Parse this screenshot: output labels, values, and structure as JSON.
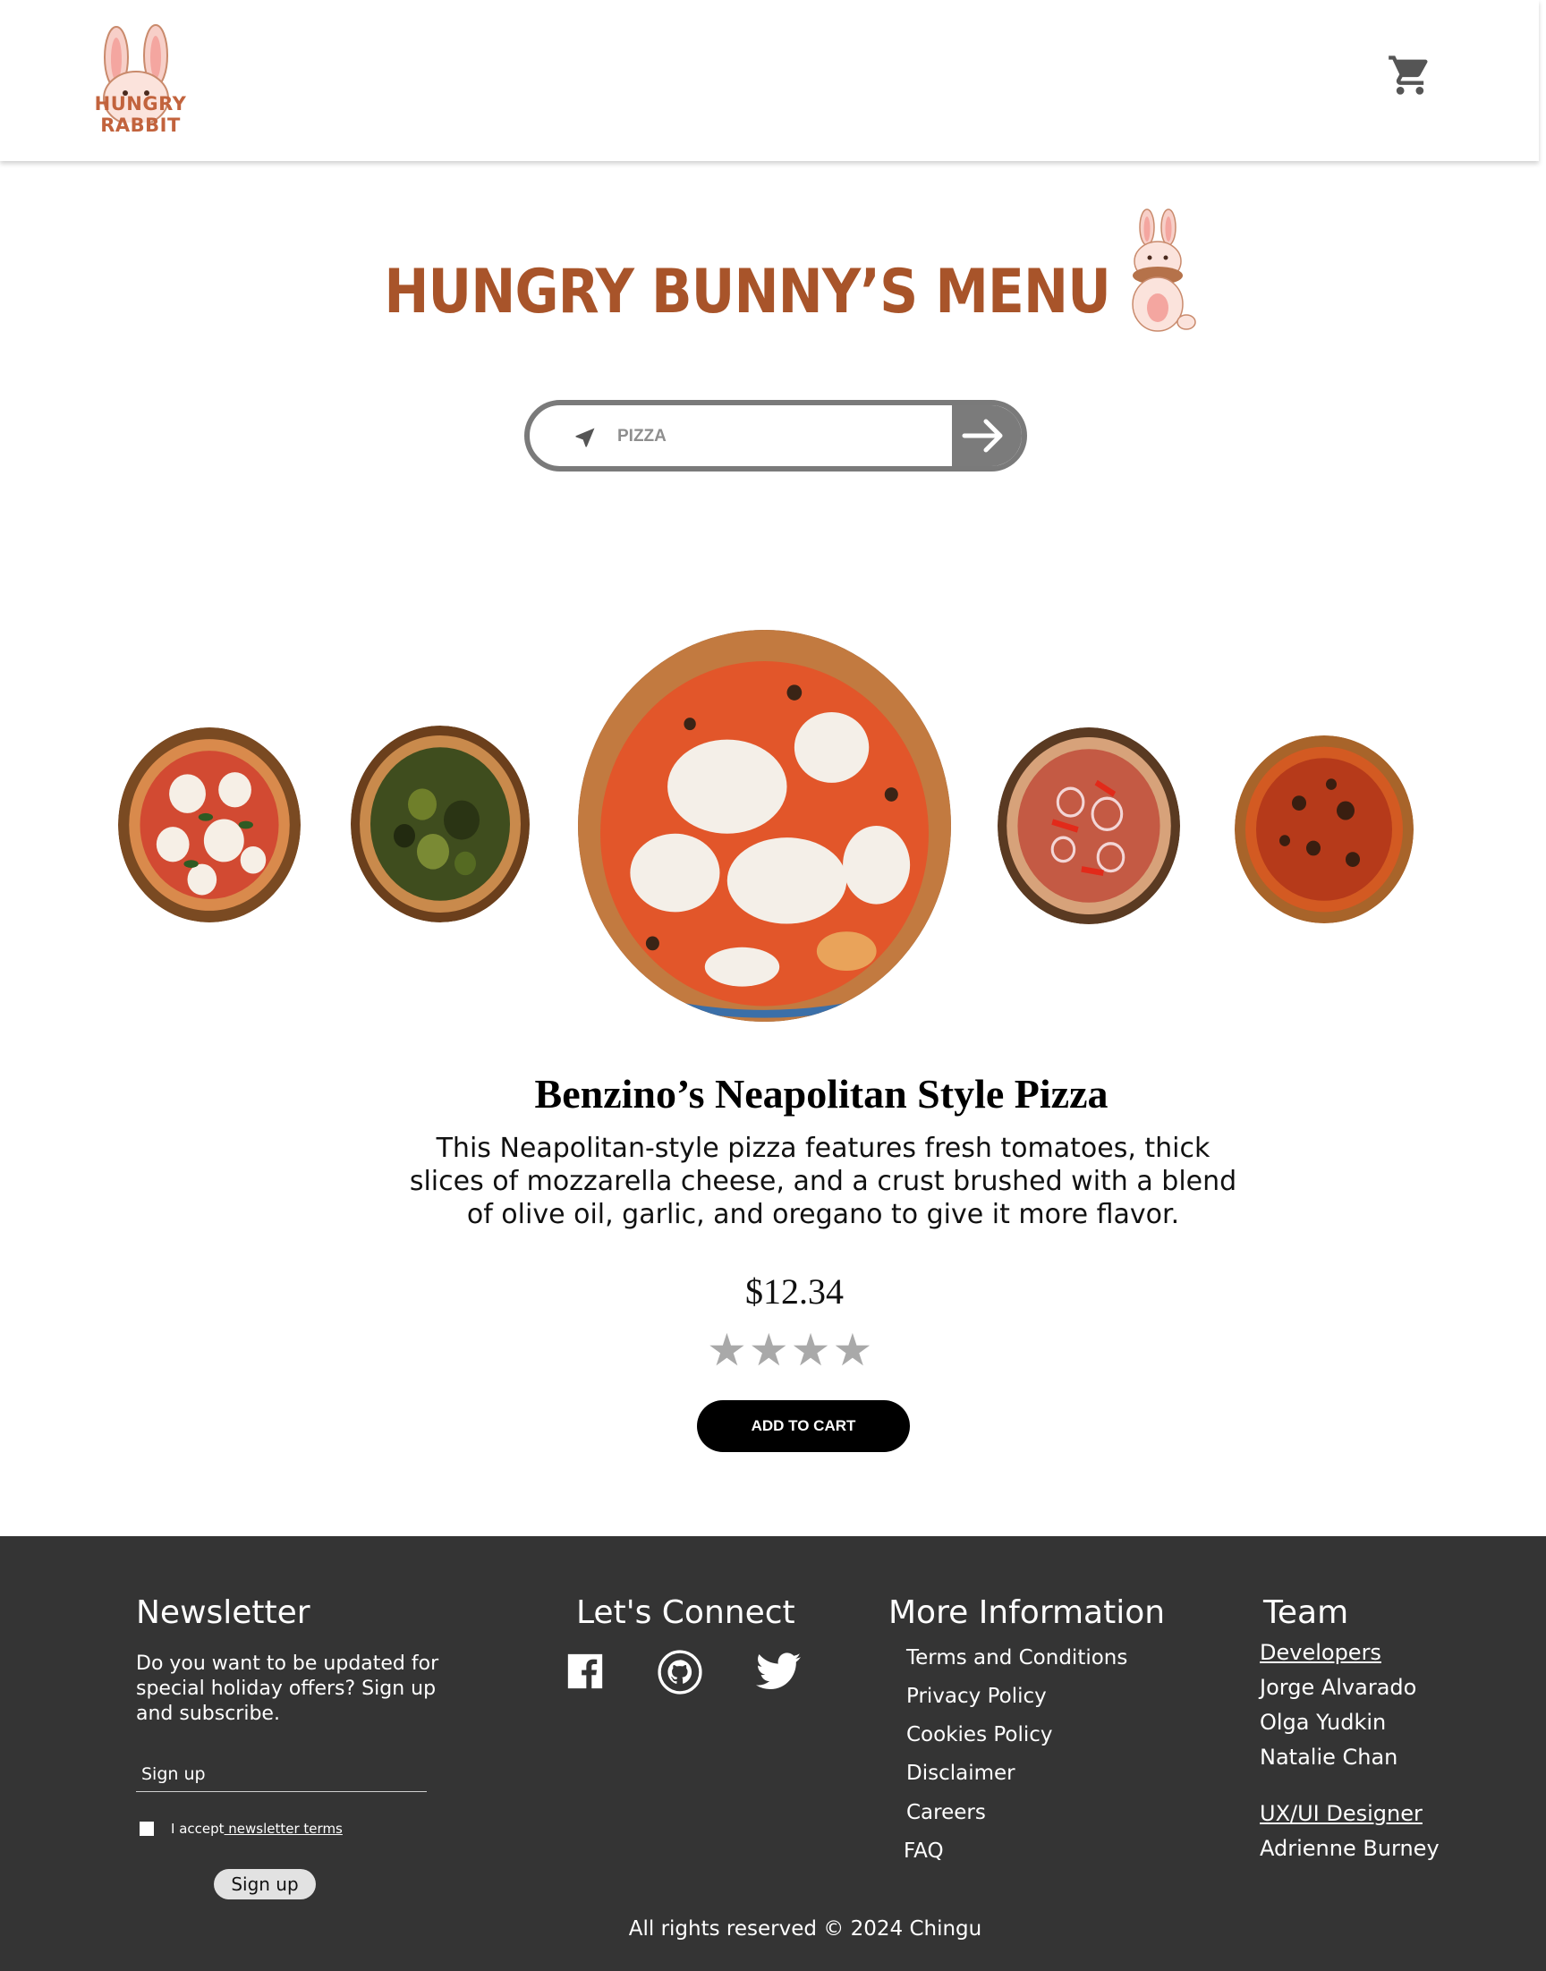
{
  "header": {
    "logo_text": "HUNGRY RABBIT",
    "cart_icon": "shopping-cart-icon"
  },
  "menu": {
    "title": "HUNGRY BUNNY’S MENU"
  },
  "search": {
    "placeholder": "PIZZA",
    "nav_icon": "navigation-arrow-icon",
    "submit_icon": "arrow-right-icon"
  },
  "carousel": {
    "items": [
      {
        "name": "margherita-pizza"
      },
      {
        "name": "spinach-pizza"
      },
      {
        "name": "neapolitan-pizza",
        "selected": true
      },
      {
        "name": "onion-pepper-pizza"
      },
      {
        "name": "tomato-pizza"
      }
    ]
  },
  "product": {
    "name": "Benzino’s Neapolitan Style Pizza",
    "description_lines": [
      "This Neapolitan-style pizza features fresh tomatoes, thick",
      "slices of mozzarella cheese, and a crust brushed with a blend",
      "of olive oil, garlic, and oregano to give it more flavor."
    ],
    "price": "$12.34",
    "rating_stars": "★★★★",
    "add_to_cart": "ADD TO CART"
  },
  "footer": {
    "newsletter": {
      "title": "Newsletter",
      "text": "Do you want to be updated for special holiday offers? Sign up and subscribe.",
      "input_placeholder": "Sign up",
      "accept_prefix": "I accept",
      "accept_link": " newsletter terms",
      "button": "Sign up"
    },
    "connect": {
      "title": "Let's Connect",
      "icons": [
        "facebook-icon",
        "github-icon",
        "twitter-icon"
      ]
    },
    "info": {
      "title": "More Information",
      "links": [
        "Terms and Conditions",
        "Privacy Policy",
        "Cookies Policy",
        "Disclaimer",
        "Careers",
        "FAQ"
      ]
    },
    "team": {
      "title": "Team",
      "developers_label": "Developers",
      "developers": [
        "Jorge Alvarado",
        "Olga Yudkin",
        "Natalie Chan"
      ],
      "designer_label": "UX/UI Designer",
      "designers": [
        "Adrienne Burney"
      ]
    },
    "copyright": "All rights reserved © 2024 Chingu"
  },
  "colors": {
    "brand": "#a8542a",
    "footer_bg": "#343434",
    "star": "#a9a9a9"
  }
}
